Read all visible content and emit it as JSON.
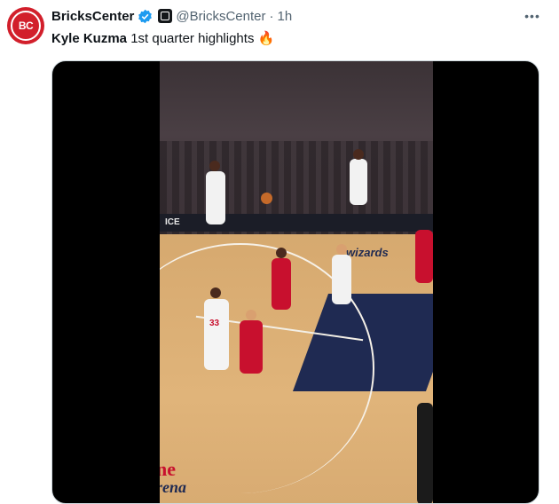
{
  "tweet": {
    "author_name": "BricksCenter",
    "handle": "@BricksCenter",
    "separator": "·",
    "time": "1h",
    "text_subject": "Kyle Kuzma",
    "text_body": " 1st quarter highlights ",
    "emoji": "🔥",
    "avatar_text": "BC"
  },
  "video": {
    "ad_board_text": "ICE",
    "court_logo_text": "wizards",
    "brand_text_line1": "ne",
    "brand_text_line2": "rena",
    "player_number": "33"
  },
  "colors": {
    "avatar_bg": "#d21f2b",
    "verified_blue": "#1d9bf0",
    "wizards_red": "#c8102e",
    "navy": "#1f2a52"
  },
  "icons": {
    "verified": "verified-badge-icon",
    "affiliation": "affiliation-badge-icon",
    "more": "more-horizontal-icon"
  }
}
